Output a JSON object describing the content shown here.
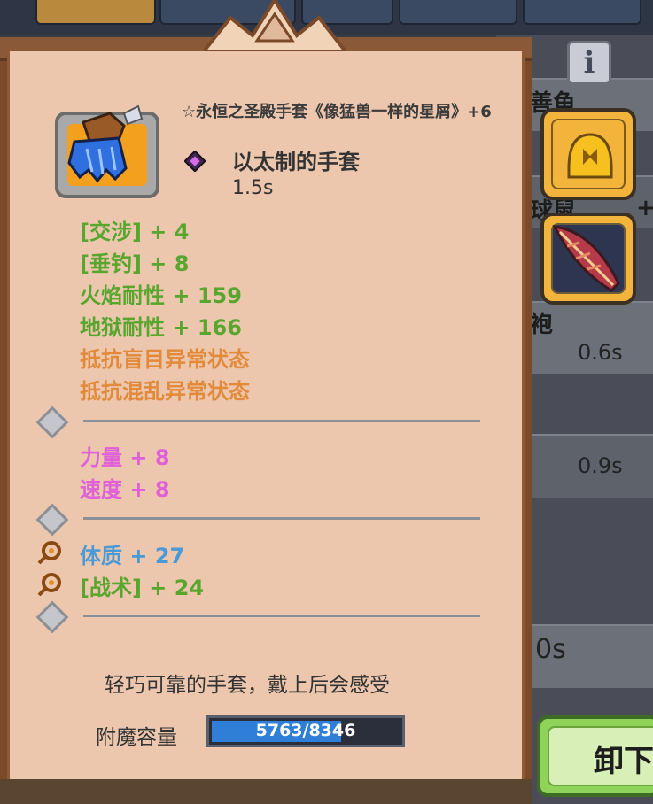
{
  "header": {
    "info_icon": "info-icon",
    "info_glyph": "i"
  },
  "background_list": {
    "partial_texts": [
      "善鱼",
      "球鼠",
      "袍"
    ],
    "times": [
      "0.6s",
      "0.9s",
      "0s"
    ],
    "plus_sign": "+"
  },
  "item": {
    "name": "☆永恒之圣殿手套《像猛兽一样的星屑》+6",
    "type": "以太制的手套",
    "speed": "1.5s",
    "icon": "blue-glove-icon",
    "gem_icon": "purple-gem-icon"
  },
  "stats": {
    "group1": [
      {
        "text": "[交涉] + 4",
        "color": "#58a62e"
      },
      {
        "text": "[垂钓] + 8",
        "color": "#58a62e"
      },
      {
        "text": "火焰耐性 + 159",
        "color": "#58a62e"
      },
      {
        "text": "地狱耐性 + 166",
        "color": "#58a62e"
      },
      {
        "text": "抵抗盲目异常状态",
        "color": "#e38a3a"
      },
      {
        "text": "抵抗混乱异常状态",
        "color": "#e38a3a"
      }
    ],
    "group2": [
      {
        "text": "力量 + 8",
        "color": "#e060d8"
      },
      {
        "text": "速度 + 8",
        "color": "#e060d8"
      }
    ],
    "group3": [
      {
        "text": "体质 + 27",
        "color": "#4a9ad8"
      },
      {
        "text": "[战术] + 24",
        "color": "#58a62e"
      }
    ]
  },
  "description": "轻巧可靠的手套，戴上后会感受",
  "enchant": {
    "label": "附魔容量",
    "value_text": "5763/8346",
    "current": 5763,
    "max": 8346
  },
  "side_slots": [
    {
      "icon": "golden-helmet-icon"
    },
    {
      "icon": "red-feather-icon"
    }
  ],
  "unequip_button": {
    "label": "卸下"
  }
}
